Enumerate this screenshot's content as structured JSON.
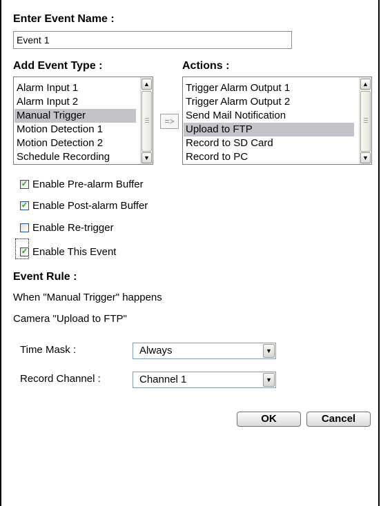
{
  "event_name": {
    "label": "Enter Event Name :",
    "value": "Event 1"
  },
  "event_type": {
    "label": "Add Event Type :",
    "items": [
      "Alarm Input 1",
      "Alarm Input 2",
      "Manual Trigger",
      "Motion Detection 1",
      "Motion Detection 2",
      "Schedule Recording"
    ],
    "selected": "Manual Trigger"
  },
  "add_button": {
    "label": "=>"
  },
  "actions": {
    "label": "Actions :",
    "items": [
      "Trigger Alarm Output 1",
      "Trigger Alarm Output 2",
      "Send Mail Notification",
      "Upload to FTP",
      "Record to SD Card",
      "Record to PC"
    ],
    "selected": "Upload to FTP"
  },
  "options": [
    {
      "label": "Enable Pre-alarm Buffer",
      "checked": true
    },
    {
      "label": "Enable Post-alarm Buffer",
      "checked": true
    },
    {
      "label": "Enable Re-trigger",
      "checked": false
    },
    {
      "label": "Enable This Event",
      "checked": true
    }
  ],
  "event_rule": {
    "label": "Event Rule :",
    "line1": "When \"Manual Trigger\" happens",
    "line2": "Camera \"Upload to FTP\""
  },
  "time_mask": {
    "label": "Time Mask :",
    "value": "Always"
  },
  "record_channel": {
    "label": "Record Channel :",
    "value": "Channel 1"
  },
  "buttons": {
    "ok": "OK",
    "cancel": "Cancel"
  },
  "icons": {
    "scroll_up": "▲",
    "scroll_down": "▼",
    "check": "✓",
    "dropdown": "▼"
  }
}
